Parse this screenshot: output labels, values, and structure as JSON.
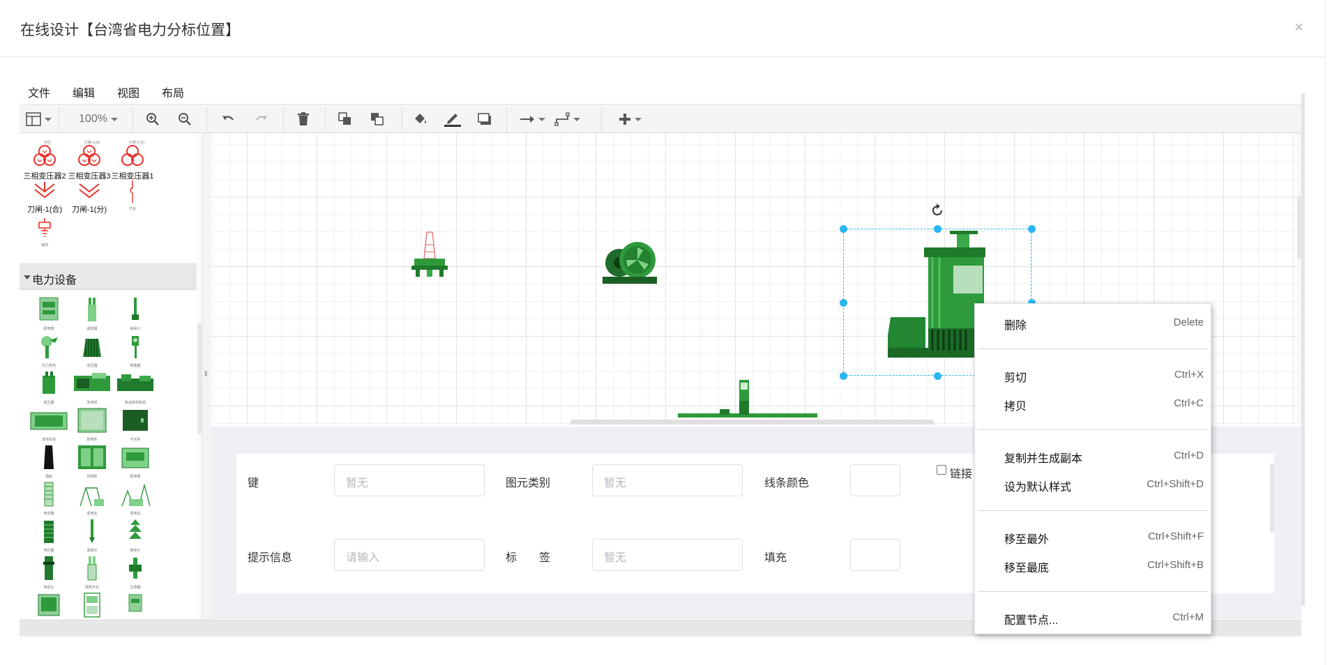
{
  "dialog": {
    "title": "在线设计【台湾省电力分标位置】",
    "close": "×"
  },
  "menu": [
    "文件",
    "编辑",
    "视图",
    "布局"
  ],
  "toolbar": {
    "zoom": "100%"
  },
  "sidebar": {
    "top_labels_cut": [
      "中压",
      "刀闸-1(合)",
      "刀闸-1(分)"
    ],
    "row1": [
      "三相变压器2",
      "三相变压器3",
      "三相变压器1"
    ],
    "row2": [
      "刀闸-1(合)",
      "刀闸-1(分)",
      "开关"
    ],
    "row3": [
      "接地"
    ],
    "section_title": "电力设备",
    "equipment_labels": [
      "配电箱",
      "避雷器",
      "绝缘子",
      "风力发电",
      "变压器",
      "断路器",
      "变压器",
      "发电机",
      "柴油发电机组",
      "发电机组",
      "配电柜",
      "开关柜",
      "烟囱",
      "控制柜",
      "配电箱",
      "电容器",
      "变电站",
      "变电站",
      "电抗器",
      "避雷针",
      "绝缘子",
      "电缆头",
      "隔离开关",
      "互感器",
      "配电柜",
      "控制箱",
      "电表"
    ]
  },
  "properties": {
    "key_label": "键",
    "key_placeholder": "暂无",
    "type_label": "图元类别",
    "type_placeholder": "暂无",
    "line_color_label": "线条颜色",
    "link_label": "链接",
    "tip_label": "提示信息",
    "tip_placeholder": "请输入",
    "tag_label": "标　　签",
    "tag_placeholder": "暂无",
    "fill_label": "填充"
  },
  "context_menu": [
    {
      "label": "删除",
      "shortcut": "Delete"
    },
    {
      "label": "剪切",
      "shortcut": "Ctrl+X"
    },
    {
      "label": "拷贝",
      "shortcut": "Ctrl+C"
    },
    {
      "label": "复制并生成副本",
      "shortcut": "Ctrl+D"
    },
    {
      "label": "设为默认样式",
      "shortcut": "Ctrl+Shift+D"
    },
    {
      "label": "移至最外",
      "shortcut": "Ctrl+Shift+F"
    },
    {
      "label": "移至最底",
      "shortcut": "Ctrl+Shift+B"
    },
    {
      "label": "配置节点...",
      "shortcut": "Ctrl+M"
    }
  ],
  "colors": {
    "accent": "#29b6f2",
    "equipment": "#2e9a3c",
    "symbol": "#e8302a"
  }
}
